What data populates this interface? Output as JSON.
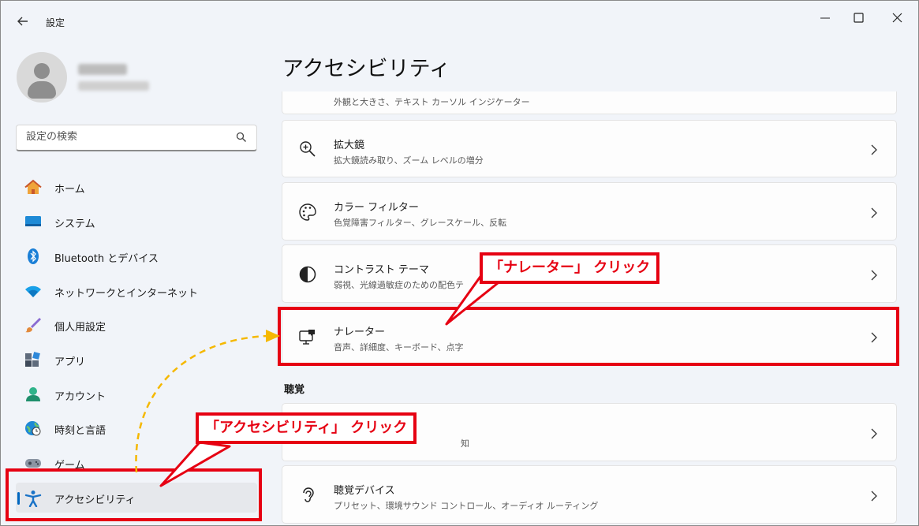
{
  "window": {
    "title": "設定",
    "back_icon": "arrow-left-icon",
    "buttons": {
      "minimize": "minimize-icon",
      "maximize": "maximize-icon",
      "close": "close-icon"
    }
  },
  "search": {
    "placeholder": "設定の検索"
  },
  "sidebar": {
    "items": [
      {
        "label": "ホーム",
        "icon": "home-icon"
      },
      {
        "label": "システム",
        "icon": "system-icon"
      },
      {
        "label": "Bluetooth とデバイス",
        "icon": "bluetooth-icon"
      },
      {
        "label": "ネットワークとインターネット",
        "icon": "wifi-icon"
      },
      {
        "label": "個人用設定",
        "icon": "brush-icon"
      },
      {
        "label": "アプリ",
        "icon": "apps-icon"
      },
      {
        "label": "アカウント",
        "icon": "account-icon"
      },
      {
        "label": "時刻と言語",
        "icon": "globe-clock-icon"
      },
      {
        "label": "ゲーム",
        "icon": "gamepad-icon"
      },
      {
        "label": "アクセシビリティ",
        "icon": "accessibility-icon",
        "selected": true
      }
    ]
  },
  "main": {
    "title": "アクセシビリティ",
    "partial_top_sub": "外観と大きさ、テキスト カーソル インジケーター",
    "cards": [
      {
        "title": "拡大鏡",
        "subtitle": "拡大鏡読み取り、ズーム レベルの増分",
        "icon": "magnifier-icon"
      },
      {
        "title": "カラー フィルター",
        "subtitle": "色覚障害フィルター、グレースケール、反転",
        "icon": "palette-icon"
      },
      {
        "title": "コントラスト テーマ",
        "subtitle": "弱視、光線過敏症のための配色テ",
        "icon": "contrast-icon"
      },
      {
        "title": "ナレーター",
        "subtitle": "音声、詳細度、キーボード、点字",
        "icon": "narrator-icon"
      }
    ],
    "section_hearing": "聴覚",
    "hearing_cards": [
      {
        "title": "",
        "subtitle": "知",
        "icon": ""
      },
      {
        "title": "聴覚デバイス",
        "subtitle": "プリセット、環境サウンド コントロール、オーディオ ルーティング",
        "icon": "hearing-icon"
      }
    ]
  },
  "annotations": {
    "narrator_callout": "「ナレーター」 クリック",
    "accessibility_callout": "「アクセシビリティ」 クリック",
    "highlight_color": "#e60012",
    "arrow_color": "#f5b800"
  }
}
